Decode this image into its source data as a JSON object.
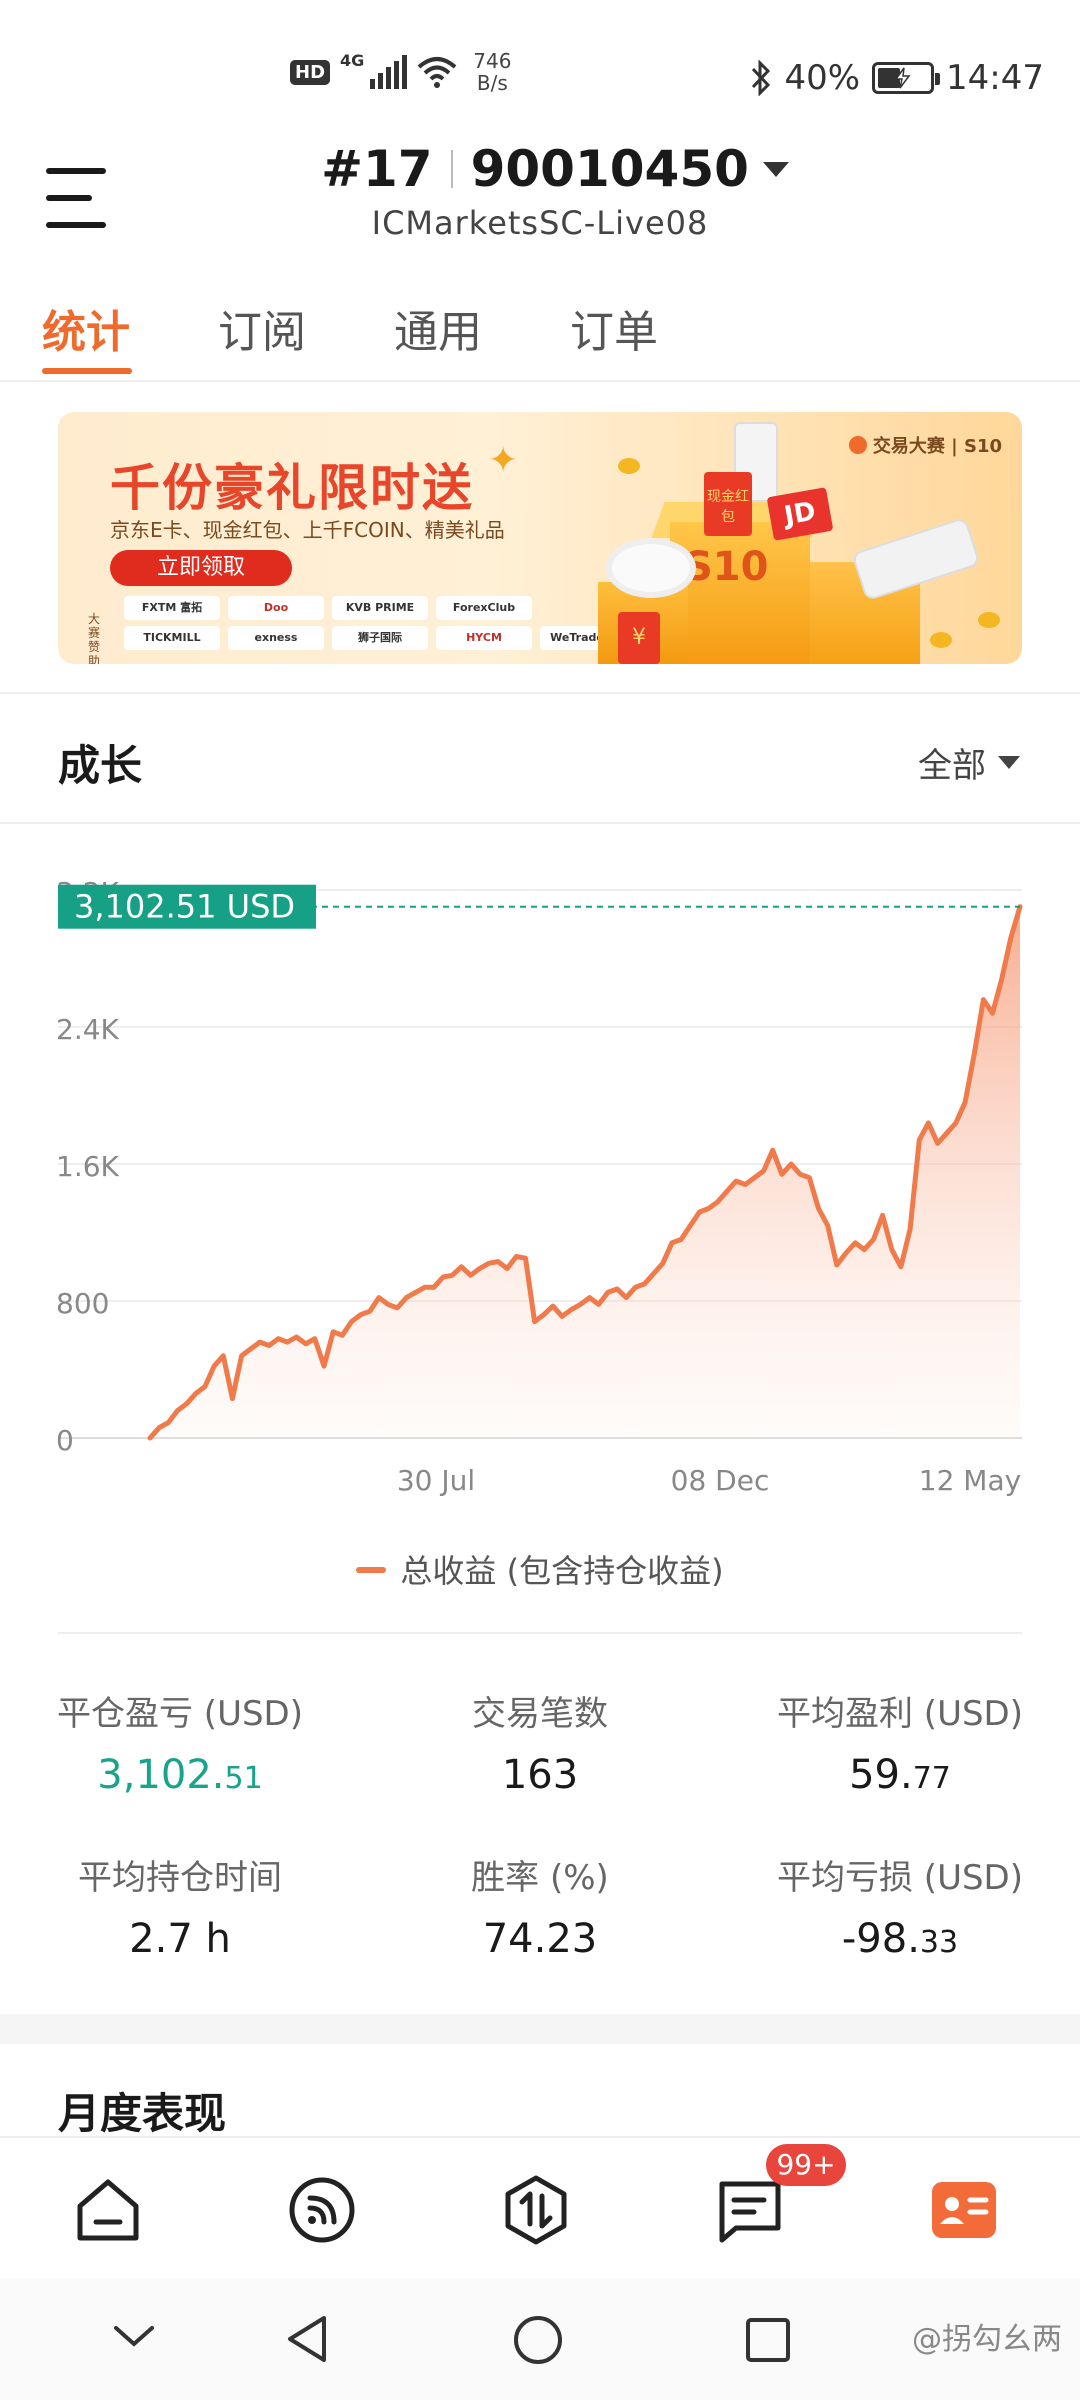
{
  "status_bar": {
    "hd": "HD",
    "network": "4G",
    "speed_value": "746",
    "speed_unit": "B/s",
    "battery": "40%",
    "time": "14:47"
  },
  "header": {
    "rank": "#17",
    "account": "90010450",
    "server": "ICMarketsSC-Live08"
  },
  "tabs": [
    {
      "label": "统计",
      "active": true
    },
    {
      "label": "订阅",
      "active": false
    },
    {
      "label": "通用",
      "active": false
    },
    {
      "label": "订单",
      "active": false
    }
  ],
  "banner": {
    "title": "千份豪礼限时送",
    "subtitle": "京东E卡、现金红包、上千FCOIN、精美礼品",
    "cta": "立即领取",
    "brand": "交易大赛 | S10",
    "sponsor_label": "大赛赞助",
    "sponsors": [
      "FXTM 富拓",
      "Doo",
      "KVB PRIME",
      "ForexClub",
      "",
      "TICKMILL",
      "exness",
      "狮子国际",
      "HYCM",
      "WeTrade众汇"
    ],
    "box_label": "S10",
    "redpack_label": "¥",
    "card_label": "现金红包",
    "id_label": "JD"
  },
  "growth": {
    "title": "成长",
    "range": "全部"
  },
  "chart_data": {
    "type": "area",
    "y_ticks": [
      "0",
      "800",
      "1.6K",
      "2.4K",
      "3.2K"
    ],
    "ylim": [
      0,
      3200
    ],
    "x_ticks": [
      "30 Jul",
      "08 Dec",
      "12 May"
    ],
    "current_value_label": "3,102.51 USD",
    "current_value": 3102.51,
    "series": [
      {
        "name": "总收益 (包含持仓收益)",
        "color": "#f07a4a",
        "values": [
          0,
          60,
          90,
          160,
          200,
          260,
          300,
          420,
          480,
          230,
          480,
          520,
          560,
          540,
          580,
          560,
          590,
          550,
          580,
          420,
          620,
          600,
          680,
          720,
          740,
          820,
          780,
          760,
          820,
          850,
          880,
          880,
          940,
          950,
          1000,
          950,
          990,
          1020,
          1030,
          990,
          1060,
          1050,
          680,
          720,
          770,
          710,
          750,
          780,
          820,
          780,
          850,
          870,
          820,
          880,
          900,
          960,
          1020,
          1140,
          1160,
          1240,
          1320,
          1340,
          1380,
          1440,
          1500,
          1480,
          1520,
          1560,
          1680,
          1540,
          1600,
          1540,
          1520,
          1340,
          1240,
          1010,
          1080,
          1140,
          1100,
          1160,
          1300,
          1100,
          1000,
          1220,
          1740,
          1840,
          1720,
          1780,
          1840,
          1960,
          2240,
          2560,
          2480,
          2680,
          2920,
          3102.51
        ]
      }
    ]
  },
  "legend": "总收益 (包含持仓收益)",
  "stats": [
    {
      "label": "平仓盈亏 (USD)",
      "int": "3,102.",
      "dec": "51",
      "green": true
    },
    {
      "label": "交易笔数",
      "int": "163",
      "dec": "",
      "green": false
    },
    {
      "label": "平均盈利 (USD)",
      "int": "59.",
      "dec": "77",
      "green": false
    },
    {
      "label": "平均持仓时间",
      "int": "2.7 h",
      "dec": "",
      "green": false
    },
    {
      "label": "胜率 (%)",
      "int": "74.23",
      "dec": "",
      "green": false
    },
    {
      "label": "平均亏损 (USD)",
      "int": "-98.",
      "dec": "33",
      "green": false
    }
  ],
  "monthly": {
    "title": "月度表现"
  },
  "bottom_nav": {
    "items": [
      "home-icon",
      "feed-icon",
      "trade-icon",
      "message-icon",
      "profile-icon"
    ],
    "badge": "99+",
    "active": 4,
    "accent": "#f06a2c"
  },
  "watermark": "@拐勾幺两"
}
